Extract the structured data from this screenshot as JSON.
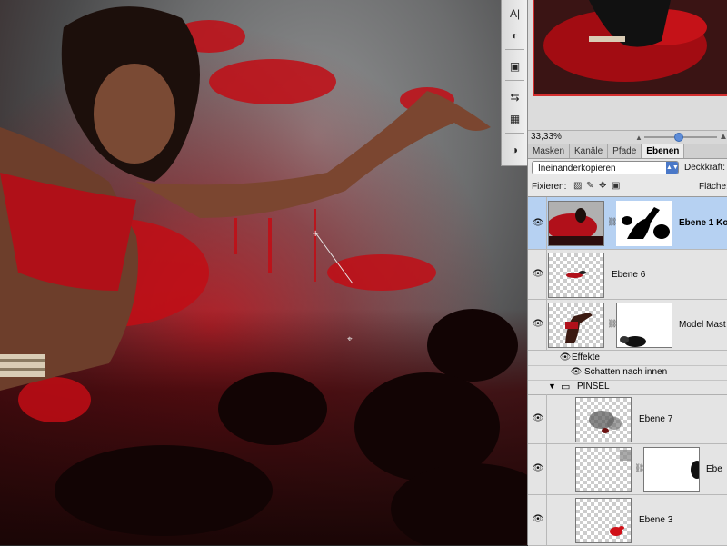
{
  "toolstrip": {
    "tools": [
      {
        "icon": "character-icon",
        "glyph": "A|"
      },
      {
        "icon": "paragraph-icon",
        "glyph": "◐"
      },
      {
        "icon": "layer-comps-icon",
        "glyph": "▣"
      },
      {
        "icon": "usb-icon",
        "glyph": "⇆"
      },
      {
        "icon": "grid-icon",
        "glyph": "▦"
      },
      {
        "icon": "adjust-icon",
        "glyph": "◑"
      }
    ]
  },
  "navigator": {
    "zoom": "33,33%"
  },
  "layers_panel": {
    "tabs": [
      "Masken",
      "Kanäle",
      "Pfade",
      "Ebenen"
    ],
    "active_tab": "Ebenen",
    "blend_mode": "Ineinanderkopieren",
    "opacity_label": "Deckkraft:",
    "lock_label": "Fixieren:",
    "fill_label": "Fläche:",
    "layers": [
      {
        "name": "Ebene 1 Ko",
        "selected": true
      },
      {
        "name": "Ebene 6"
      },
      {
        "name": "Model Mast"
      },
      {
        "name": "Effekte"
      },
      {
        "name": "Schatten nach innen"
      },
      {
        "name": "PINSEL"
      },
      {
        "name": "Ebene 7"
      },
      {
        "name": "Ebe"
      },
      {
        "name": "Ebene 3"
      }
    ]
  },
  "colors": {
    "accent_red": "#d01018",
    "selection_blue": "#b6d1f2",
    "panel_bg": "#e8e8e8"
  }
}
